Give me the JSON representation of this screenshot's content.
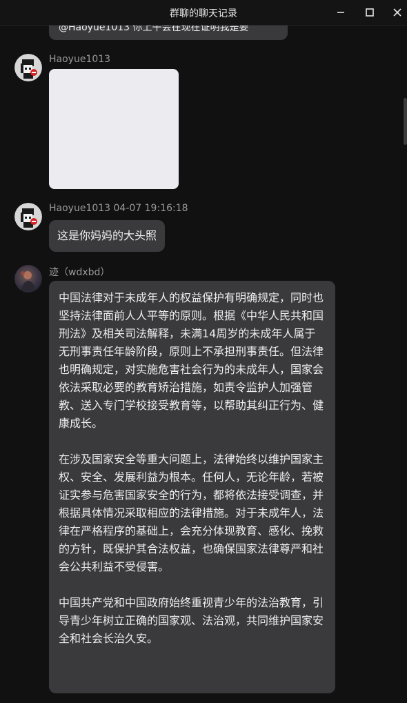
{
  "window": {
    "title": "群聊的聊天记录"
  },
  "messages": {
    "partial_text": "@Haoyue1013 你上午会在现在证明我是要",
    "m1": {
      "sender": "Haoyue1013",
      "avatar_icon": "pixel-avatar-icon"
    },
    "m2": {
      "sender": "Haoyue1013 04-07 19:16:18",
      "text": "这是你妈妈的大头照",
      "avatar_icon": "pixel-avatar-icon"
    },
    "m3": {
      "sender": "迹（wdxbd）",
      "avatar_icon": "photo-avatar-icon",
      "paragraphs": [
        "中国法律对于未成年人的权益保护有明确规定，同时也坚持法律面前人人平等的原则。根据《中华人民共和国刑法》及相关司法解释，未满14周岁的未成年人属于无刑事责任年龄阶段，原则上不承担刑事责任。但法律也明确规定，对实施危害社会行为的未成年人，国家会依法采取必要的教育矫治措施，如责令监护人加强管教、送入专门学校接受教育等，以帮助其纠正行为、健康成长。",
        "在涉及国家安全等重大问题上，法律始终以维护国家主权、安全、发展利益为根本。任何人，无论年龄，若被证实参与危害国家安全的行为，都将依法接受调查，并根据具体情况采取相应的法律措施。对于未成年人，法律在严格程序的基础上，会充分体现教育、感化、挽救的方针，既保护其合法权益，也确保国家法律尊严和社会公共利益不受侵害。",
        "中国共产党和中国政府始终重视青少年的法治教育，引导青少年树立正确的国家观、法治观，共同维护国家安全和社会长治久安。"
      ]
    }
  },
  "colors": {
    "background": "#111111",
    "bubble": "#3a3a3c",
    "text": "#eeeeee",
    "name": "#9a9a9a"
  }
}
